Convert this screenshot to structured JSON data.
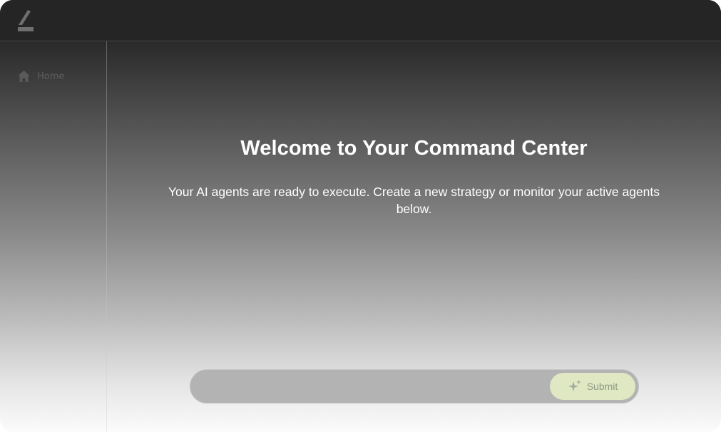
{
  "app": {
    "logo_icon": "brand-logo-icon"
  },
  "sidebar": {
    "items": [
      {
        "label": "Home",
        "icon": "home-icon"
      }
    ]
  },
  "main": {
    "title": "Welcome to Your Command Center",
    "subtitle": "Your AI agents are ready to execute. Create a new strategy or monitor your active agents below."
  },
  "prompt": {
    "value": "",
    "submit_label": "Submit",
    "submit_icon": "sparkle-icon"
  },
  "colors": {
    "topbar": "#252525",
    "submit_bg": "#dfe8c3",
    "submit_text": "#8e9a84",
    "input_bg": "#b3b3b3"
  }
}
